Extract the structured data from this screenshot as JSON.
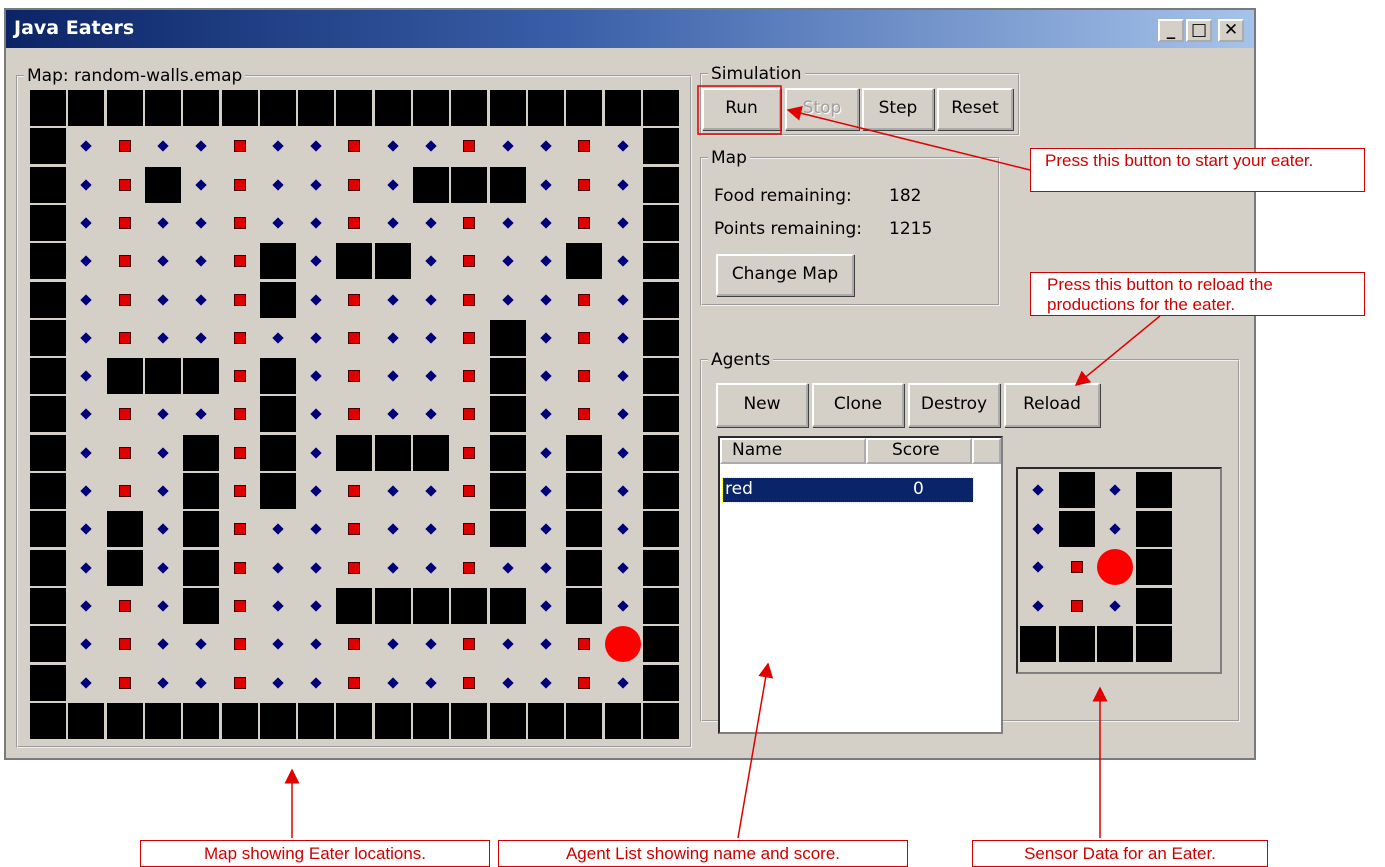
{
  "window": {
    "title": "Java Eaters",
    "controls": {
      "minimize": "_",
      "maximize": "□",
      "close": "✕"
    }
  },
  "map_panel": {
    "legend": "Map: random-walls.emap"
  },
  "simulation": {
    "legend": "Simulation",
    "run": "Run",
    "stop": "Stop",
    "step": "Step",
    "reset": "Reset"
  },
  "map_info": {
    "legend": "Map",
    "food_label": "Food remaining:",
    "food_value": "182",
    "points_label": "Points remaining:",
    "points_value": "1215",
    "change_map": "Change Map"
  },
  "agents": {
    "legend": "Agents",
    "new": "New",
    "clone": "Clone",
    "destroy": "Destroy",
    "reload": "Reload",
    "columns": [
      "Name",
      "Score"
    ],
    "rows": [
      {
        "name": "red",
        "score": "0"
      }
    ]
  },
  "grid": {
    "size": 17,
    "rows": [
      "WWWWWWWWWWWWWWWWW",
      "WnbnnbnnbnnbnnbnW",
      "WnbWnbnnbnWWWnbnW",
      "WnbnnbnnbnnbnnbnW",
      "WnbnnbWnWWnbnnWnW",
      "WnbnnbWnbnnbnnbnW",
      "WnbnnbnnbnnbWnbnW",
      "WnWWWbWnbnnbWnbnW",
      "WnbnnbWnbnnbWnbnW",
      "WnbnWbWnWWWbWnWnW",
      "WnbnWbWnbnnbWnWnW",
      "WnWnWbnnbnnbWnWnW",
      "WnWnWbnnbnnbnnWnW",
      "WnbnWbnnWWWWWnWnW",
      "WnbnnbnnbnnbnnbEW",
      "WnbnnbnnbnnbnnbnW",
      "WWWWWWWWWWWWWWWWW"
    ]
  },
  "sensor": {
    "rows": [
      "nWnW",
      "nWnW",
      "nbEW",
      "nbnW",
      "WWWW"
    ]
  },
  "annotations": {
    "run_note": "Press this button to start your eater.",
    "reload_note": "Press this button to reload the productions for the eater.",
    "map_note": "Map showing Eater locations.",
    "agent_note": "Agent List showing name and score.",
    "sensor_note": "Sensor Data for an Eater."
  },
  "colors": {
    "wall": "#000000",
    "normal_food": "#00007a",
    "bonus_food": "#e00000",
    "eater": "#ff0000",
    "annotation": "#d00000"
  }
}
